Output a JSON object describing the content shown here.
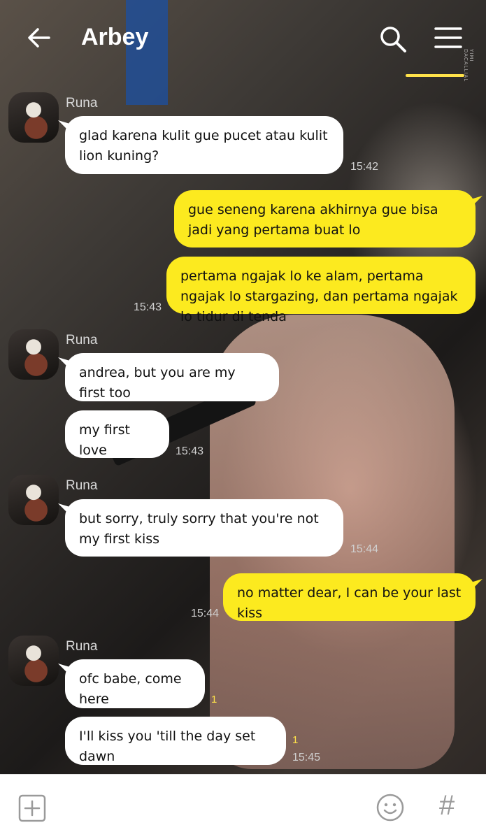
{
  "header": {
    "title": "Arbey",
    "watermark": "YIMI DACALLIAL"
  },
  "messages": [
    {
      "sender": "Runa",
      "text": "glad karena kulit gue pucet atau kulit lion kuning?",
      "time": "15:42"
    },
    {
      "text": "gue seneng karena akhirnya gue bisa jadi yang pertama buat lo"
    },
    {
      "text": "pertama ngajak lo ke alam, pertama ngajak lo stargazing, dan pertama ngajak lo tidur di tenda",
      "time": "15:43"
    },
    {
      "sender": "Runa",
      "text": "andrea, but you are my first too"
    },
    {
      "text": "my first love",
      "time": "15:43"
    },
    {
      "sender": "Runa",
      "text": "but sorry, truly sorry that you're not my first kiss",
      "time": "15:44"
    },
    {
      "text": "no matter dear, I can be your last kiss",
      "time": "15:44"
    },
    {
      "sender": "Runa",
      "text": "ofc babe, come here",
      "read": "1"
    },
    {
      "text": "I'll kiss you 'till the day set dawn",
      "read": "1",
      "time": "15:45"
    }
  ],
  "footer": {
    "hash_label": "#"
  },
  "colors": {
    "outgoing_bubble": "#fcea1f",
    "incoming_bubble": "#ffffff",
    "accent": "#ffe24a"
  }
}
